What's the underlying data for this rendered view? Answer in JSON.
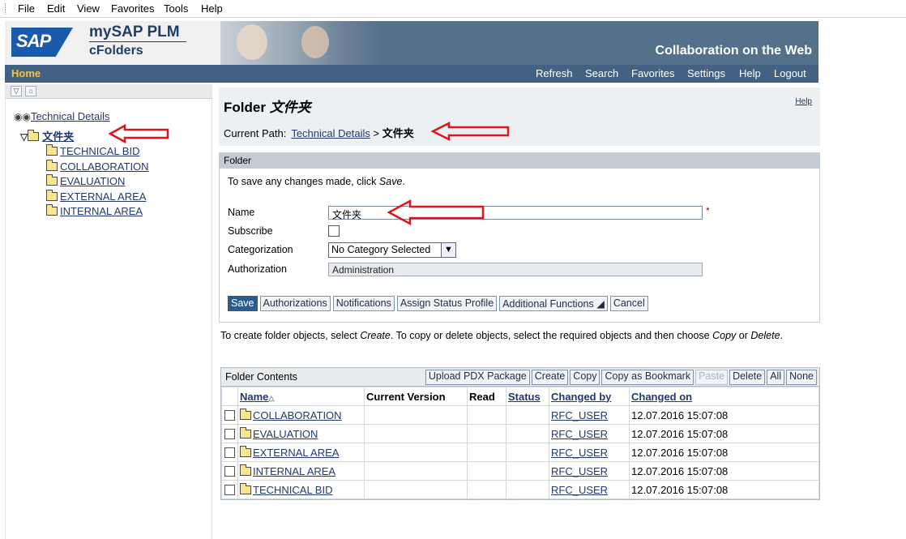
{
  "menu": [
    "File",
    "Edit",
    "View",
    "Favorites",
    "Tools",
    "Help"
  ],
  "banner": {
    "logo": "SAP",
    "product": "mySAP PLM",
    "sub": "cFolders",
    "tagline": "Collaboration on the Web"
  },
  "nav": {
    "home": "Home",
    "links": [
      "Refresh",
      "Search",
      "Favorites",
      "Settings",
      "Help",
      "Logout"
    ]
  },
  "tree": {
    "root": "Technical Details",
    "selected": "文件夹",
    "children": [
      "TECHNICAL BID",
      "COLLABORATION",
      "EVALUATION",
      "EXTERNAL AREA",
      "INTERNAL AREA"
    ]
  },
  "header": {
    "title_prefix": "Folder",
    "title_name": "文件夹",
    "help": "Help",
    "path_label": "Current Path:",
    "path_link": "Technical Details",
    "path_sep": ">",
    "path_current": "文件夹"
  },
  "folder_panel": {
    "header": "Folder",
    "hint_prefix": "To save any changes made, click",
    "hint_action": "Save",
    "hint_suffix": ".",
    "name_label": "Name",
    "name_value": "文件夹",
    "required": "*",
    "subscribe_label": "Subscribe",
    "category_label": "Categorization",
    "category_value": "No Category Selected",
    "authorization_label": "Authorization",
    "authorization_value": "Administration",
    "buttons": {
      "save": "Save",
      "authorizations": "Authorizations",
      "notifications": "Notifications",
      "assign_status": "Assign Status Profile",
      "additional": "Additional Functions ◢",
      "cancel": "Cancel"
    }
  },
  "create_hint": {
    "p1": "To create folder objects, select",
    "create": "Create",
    "p2": ". To copy or delete objects, select the required objects and then choose",
    "copy": "Copy",
    "p3": "or",
    "delete": "Delete",
    "p4": "."
  },
  "contents": {
    "title": "Folder Contents",
    "buttons": {
      "upload": "Upload PDX Package",
      "create": "Create",
      "copy": "Copy",
      "copy_bookmark": "Copy as Bookmark",
      "paste": "Paste",
      "delete": "Delete",
      "all": "All",
      "none": "None"
    },
    "columns": {
      "name": "Name",
      "sort": "△",
      "version": "Current Version",
      "read": "Read",
      "status": "Status",
      "changed_by": "Changed by",
      "changed_on": "Changed on"
    },
    "rows": [
      {
        "name": "COLLABORATION",
        "by": "RFC_USER",
        "on": "12.07.2016 15:07:08"
      },
      {
        "name": "EVALUATION",
        "by": "RFC_USER",
        "on": "12.07.2016 15:07:08"
      },
      {
        "name": "EXTERNAL AREA",
        "by": "RFC_USER",
        "on": "12.07.2016 15:07:08"
      },
      {
        "name": "INTERNAL AREA",
        "by": "RFC_USER",
        "on": "12.07.2016 15:07:08"
      },
      {
        "name": "TECHNICAL BID",
        "by": "RFC_USER",
        "on": "12.07.2016 15:07:08"
      }
    ]
  },
  "colors": {
    "banner": "#55708a",
    "navbar": "#436283",
    "home": "#f6c445",
    "link": "#22396e",
    "annotation_arrow": "#e0141b"
  }
}
